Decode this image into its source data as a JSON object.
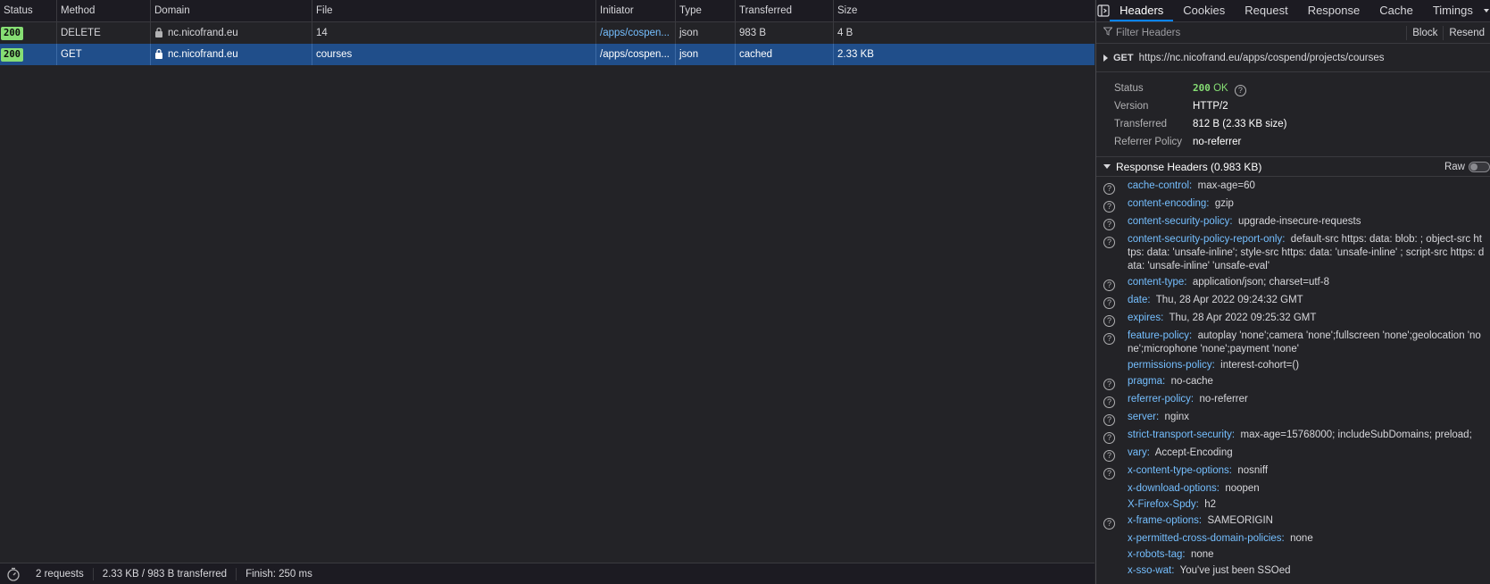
{
  "columns": [
    "Status",
    "Method",
    "Domain",
    "File",
    "Initiator",
    "Type",
    "Transferred",
    "Size"
  ],
  "requests": [
    {
      "status": "200",
      "method": "DELETE",
      "domain": "nc.nicofrand.eu",
      "file": "14",
      "initiator": "/apps/cospen...",
      "type": "json",
      "transferred": "983 B",
      "size": "4 B",
      "selected": false
    },
    {
      "status": "200",
      "method": "GET",
      "domain": "nc.nicofrand.eu",
      "file": "courses",
      "initiator": "/apps/cospen...",
      "type": "json",
      "transferred": "cached",
      "size": "2.33 KB",
      "selected": true
    }
  ],
  "statusbar": {
    "requests": "2 requests",
    "transferred": "2.33 KB / 983 B transferred",
    "finish": "Finish: 250 ms"
  },
  "details": {
    "tabs": [
      "Headers",
      "Cookies",
      "Request",
      "Response",
      "Cache",
      "Timings"
    ],
    "active_tab": "Headers",
    "filter_placeholder": "Filter Headers",
    "block_label": "Block",
    "resend_label": "Resend",
    "request_method": "GET",
    "request_url": "https://nc.nicofrand.eu/apps/cospend/projects/courses",
    "summary": {
      "status_label": "Status",
      "status_code": "200",
      "status_text": "OK",
      "version_label": "Version",
      "version": "HTTP/2",
      "transferred_label": "Transferred",
      "transferred": "812 B (2.33 KB size)",
      "referrer_label": "Referrer Policy",
      "referrer": "no-referrer"
    },
    "response_headers_title": "Response Headers (0.983 KB)",
    "raw_label": "Raw",
    "headers": [
      {
        "name": "cache-control:",
        "value": "max-age=60",
        "help": true
      },
      {
        "name": "content-encoding:",
        "value": "gzip",
        "help": true
      },
      {
        "name": "content-security-policy:",
        "value": "upgrade-insecure-requests",
        "help": true
      },
      {
        "name": "content-security-policy-report-only:",
        "value": "default-src https: data: blob: ; object-src https: data: 'unsafe-inline'; style-src https: data: 'unsafe-inline' ; script-src https: data: 'unsafe-inline' 'unsafe-eval'",
        "help": true
      },
      {
        "name": "content-type:",
        "value": "application/json; charset=utf-8",
        "help": true
      },
      {
        "name": "date:",
        "value": "Thu, 28 Apr 2022 09:24:32 GMT",
        "help": true
      },
      {
        "name": "expires:",
        "value": "Thu, 28 Apr 2022 09:25:32 GMT",
        "help": true
      },
      {
        "name": "feature-policy:",
        "value": "autoplay 'none';camera 'none';fullscreen 'none';geolocation 'none';microphone 'none';payment 'none'",
        "help": true
      },
      {
        "name": "permissions-policy:",
        "value": "interest-cohort=()",
        "help": false
      },
      {
        "name": "pragma:",
        "value": "no-cache",
        "help": true
      },
      {
        "name": "referrer-policy:",
        "value": "no-referrer",
        "help": true
      },
      {
        "name": "server:",
        "value": "nginx",
        "help": true
      },
      {
        "name": "strict-transport-security:",
        "value": "max-age=15768000; includeSubDomains; preload;",
        "help": true
      },
      {
        "name": "vary:",
        "value": "Accept-Encoding",
        "help": true
      },
      {
        "name": "x-content-type-options:",
        "value": "nosniff",
        "help": true
      },
      {
        "name": "x-download-options:",
        "value": "noopen",
        "help": false
      },
      {
        "name": "X-Firefox-Spdy:",
        "value": "h2",
        "help": false
      },
      {
        "name": "x-frame-options:",
        "value": "SAMEORIGIN",
        "help": true
      },
      {
        "name": "x-permitted-cross-domain-policies:",
        "value": "none",
        "help": false
      },
      {
        "name": "x-robots-tag:",
        "value": "none",
        "help": false
      },
      {
        "name": "x-sso-wat:",
        "value": "You've just been SSOed",
        "help": false
      }
    ]
  },
  "colors": {
    "accent": "#0a84ff",
    "selected_row": "#204e8a",
    "status_ok": "#86de74",
    "header_name": "#75bfff"
  }
}
